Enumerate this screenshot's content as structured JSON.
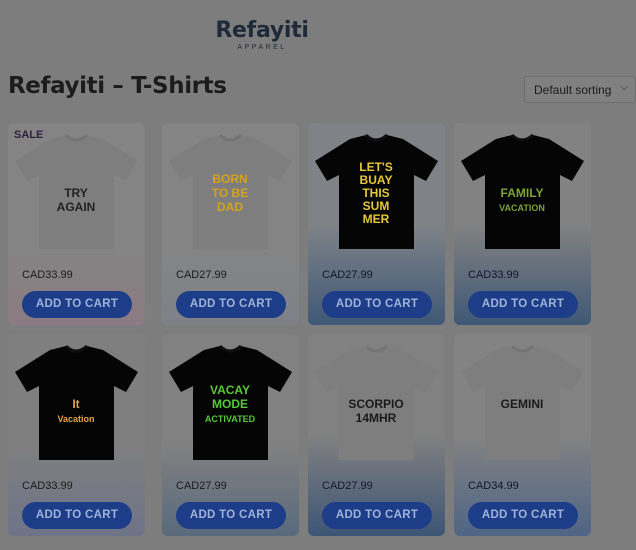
{
  "brand": {
    "name": "Refayiti",
    "tagline": "APPAREL"
  },
  "page": {
    "title": "Refayiti – T-Shirts"
  },
  "sorting": {
    "selected": "Default sorting"
  },
  "products": [
    {
      "price": "CAD33.99",
      "button": "ADD TO CART",
      "badge": "SALE",
      "shirt_color": "white",
      "print_text": [
        "TRY",
        "AGAIN"
      ],
      "print_color": "#222222"
    },
    {
      "price": "CAD27.99",
      "button": "ADD TO CART",
      "shirt_color": "white",
      "print_text": [
        "BORN",
        "TO BE",
        "DAD"
      ],
      "print_color": "#d4a31d"
    },
    {
      "price": "CAD27.99",
      "button": "ADD TO CART",
      "shirt_color": "black",
      "print_text": [
        "LET'S",
        "BUAY",
        "THIS",
        "SUM",
        "MER"
      ],
      "print_color": "#e5c73a"
    },
    {
      "price": "CAD33.99",
      "button": "ADD TO CART",
      "shirt_color": "black",
      "print_text": [
        "FAMILY",
        "VACATION"
      ],
      "print_color": "#7da238"
    },
    {
      "price": "CAD33.99",
      "button": "ADD TO CART",
      "shirt_color": "black",
      "print_text": [
        "It",
        "Vacation"
      ],
      "print_color": "#e5a34a"
    },
    {
      "price": "CAD27.99",
      "button": "ADD TO CART",
      "shirt_color": "black",
      "print_text": [
        "VACAY",
        "MODE",
        "ACTIVATED"
      ],
      "print_color": "#57c83a"
    },
    {
      "price": "CAD27.99",
      "button": "ADD TO CART",
      "shirt_color": "white",
      "print_text": [
        "SCORPIO",
        "14MHR"
      ],
      "print_color": "#1a1a1a"
    },
    {
      "price": "CAD34.99",
      "button": "ADD TO CART",
      "shirt_color": "white",
      "print_text": [
        "GEMINI"
      ],
      "print_color": "#1a1a1a"
    }
  ],
  "colors": {
    "overlay": "#7d7d7d",
    "button": "#1e3d89",
    "button_text": "#9fb2d8",
    "text": "#1c1c1c"
  }
}
